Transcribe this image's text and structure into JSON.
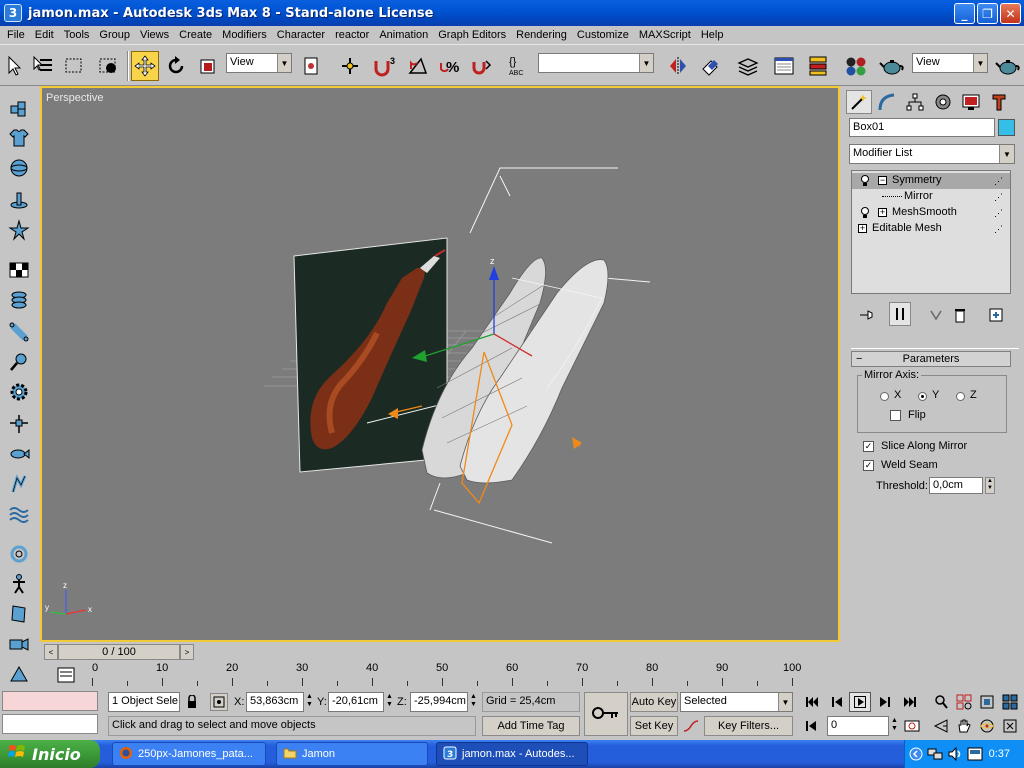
{
  "window": {
    "title": "jamon.max - Autodesk 3ds Max 8  - Stand-alone License",
    "app_icon": "3ds-max-icon"
  },
  "menubar": [
    "File",
    "Edit",
    "Tools",
    "Group",
    "Views",
    "Create",
    "Modifiers",
    "Character",
    "reactor",
    "Animation",
    "Graph Editors",
    "Rendering",
    "Customize",
    "MAXScript",
    "Help"
  ],
  "toolbar": {
    "ref_coord": "View",
    "named_selection": "",
    "render_view": "View",
    "snap_angle_label": "3"
  },
  "viewport": {
    "label": "Perspective",
    "border_color": "#f3c935",
    "background": "#7c7c7c"
  },
  "command_panel": {
    "object_name": "Box01",
    "object_color": "#36bfe6",
    "modifier_list": "Modifier List",
    "stack": [
      {
        "label": "Symmetry",
        "selected": true
      },
      {
        "label": "Mirror",
        "sub": true
      },
      {
        "label": "MeshSmooth"
      },
      {
        "label": "Editable Mesh"
      }
    ],
    "parameters": {
      "title": "Parameters",
      "mirror_axis_label": "Mirror Axis:",
      "axes": [
        "X",
        "Y",
        "Z"
      ],
      "selected_axis": "Y",
      "flip_label": "Flip",
      "slice_label": "Slice Along Mirror",
      "weld_label": "Weld Seam",
      "threshold_label": "Threshold:",
      "threshold_value": "0,0cm"
    }
  },
  "timeline": {
    "slider": "0 / 100",
    "ticks": [
      "0",
      "10",
      "20",
      "30",
      "40",
      "50",
      "60",
      "70",
      "80",
      "90",
      "100"
    ]
  },
  "status": {
    "selection": "1 Object Sele",
    "x_label": "X:",
    "x_value": "53,863cm",
    "y_label": "Y:",
    "y_value": "-20,61cm",
    "z_label": "Z:",
    "z_value": "-25,994cm",
    "grid": "Grid = 25,4cm",
    "prompt": "Click and drag to select and move objects",
    "add_time_tag": "Add Time Tag",
    "auto_key": "Auto Key",
    "set_key": "Set Key",
    "key_mode": "Selected",
    "key_filters": "Key Filters...",
    "frame": "0"
  },
  "taskbar": {
    "start": "Inicio",
    "tasks": [
      {
        "label": "250px-Jamones_pata...",
        "icon": "firefox-icon"
      },
      {
        "label": "Jamon",
        "icon": "folder-icon"
      },
      {
        "label": "jamon.max - Autodes...",
        "icon": "3ds-max-icon",
        "active": true
      }
    ],
    "clock": "0:37"
  }
}
